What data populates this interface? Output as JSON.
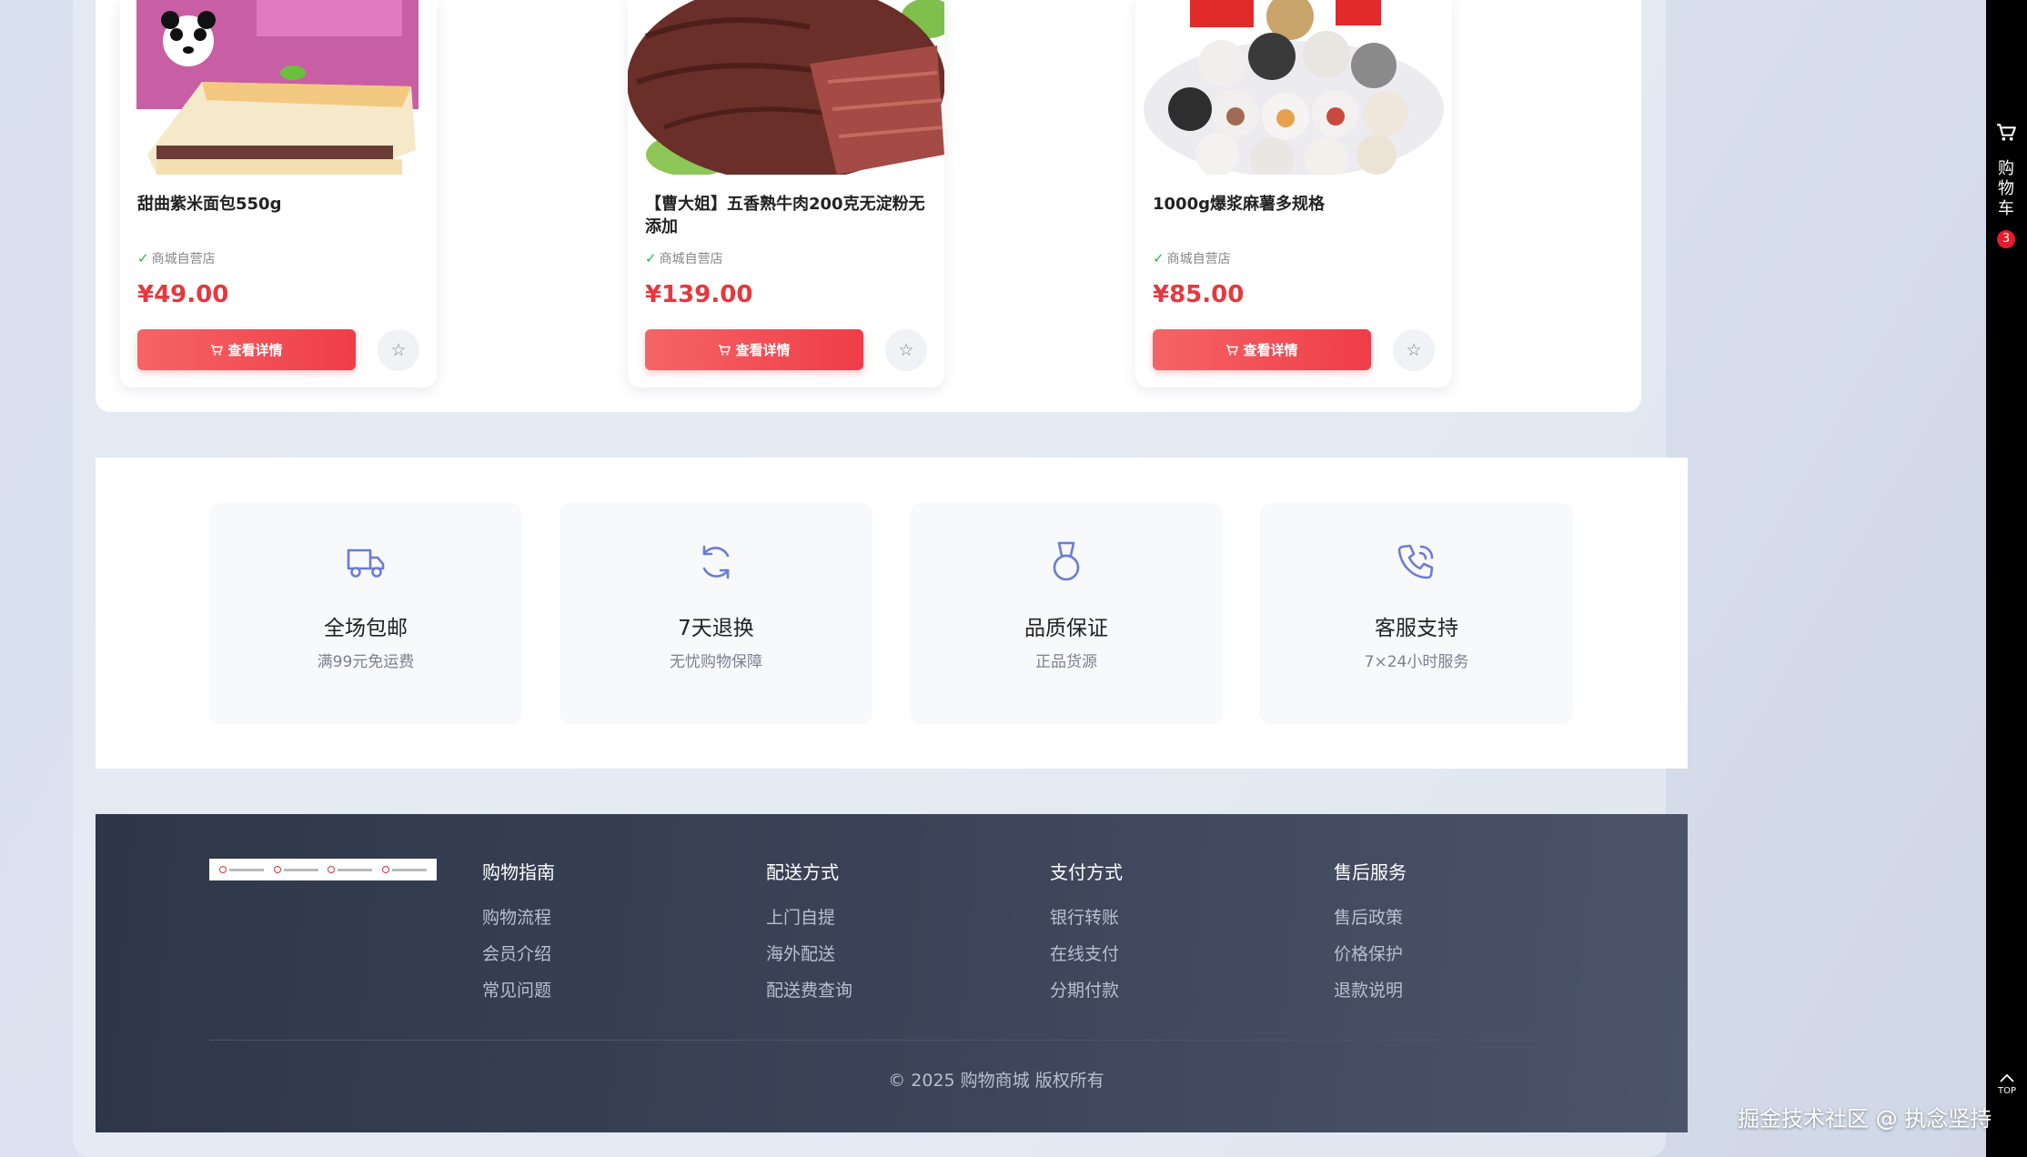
{
  "products": [
    {
      "name": "甜曲紫米面包550g",
      "shop": "商城自营店",
      "price": "¥49.00",
      "button_label": "查看详情"
    },
    {
      "name": "【曹大姐】五香熟牛肉200克无淀粉无添加",
      "shop": "商城自营店",
      "price": "¥139.00",
      "button_label": "查看详情"
    },
    {
      "name": "1000g爆浆麻薯多规格",
      "shop": "商城自营店",
      "price": "¥85.00",
      "button_label": "查看详情"
    }
  ],
  "features": [
    {
      "icon": "truck-icon",
      "title": "全场包邮",
      "subtitle": "满99元免运费"
    },
    {
      "icon": "refresh-icon",
      "title": "7天退换",
      "subtitle": "无忧购物保障"
    },
    {
      "icon": "medal-icon",
      "title": "品质保证",
      "subtitle": "正品货源"
    },
    {
      "icon": "phone-icon",
      "title": "客服支持",
      "subtitle": "7×24小时服务"
    }
  ],
  "footer": {
    "columns": [
      {
        "title": "购物指南",
        "links": [
          "购物流程",
          "会员介绍",
          "常见问题"
        ]
      },
      {
        "title": "配送方式",
        "links": [
          "上门自提",
          "海外配送",
          "配送费查询"
        ]
      },
      {
        "title": "支付方式",
        "links": [
          "银行转账",
          "在线支付",
          "分期付款"
        ]
      },
      {
        "title": "售后服务",
        "links": [
          "售后政策",
          "价格保护",
          "退款说明"
        ]
      }
    ],
    "copyright": "© 2025 购物商城 版权所有"
  },
  "sidebar": {
    "cart_label": "购物车",
    "cart_count": "3",
    "top_label": "TOP"
  },
  "watermark": "掘金技术社区 @ 执念坚持",
  "colors": {
    "accent": "#ef3d48",
    "feature_icon": "#6b7bd8",
    "footer_bg": "#3b4358"
  }
}
